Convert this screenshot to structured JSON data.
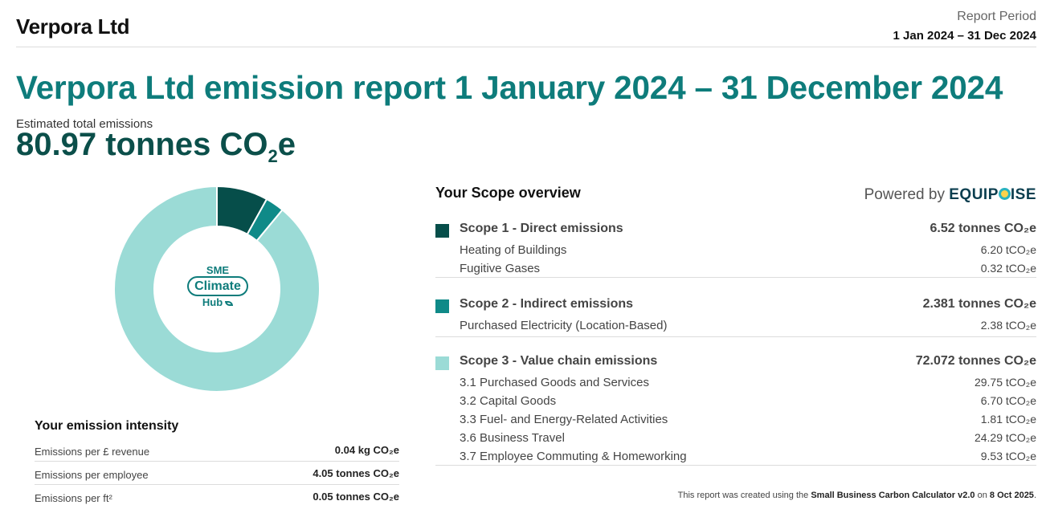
{
  "header": {
    "company": "Verpora Ltd",
    "period_label": "Report Period",
    "period_value": "1 Jan 2024 – 31 Dec 2024"
  },
  "title": "Verpora Ltd emission report 1 January 2024 – 31 December 2024",
  "total": {
    "label": "Estimated total emissions",
    "value": "80.97 tonnes CO",
    "sub": "2",
    "suffix": "e"
  },
  "logo": {
    "line1": "SME",
    "line2": "Climate",
    "line3": "Hub"
  },
  "colors": {
    "scope1": "#064e4a",
    "scope2": "#0f8a88",
    "scope3": "#9bdbd6",
    "accent": "#0e7c7b"
  },
  "chart_data": {
    "type": "pie",
    "donut": true,
    "slices": [
      {
        "name": "Scope 1 - Direct emissions",
        "value": 6.52
      },
      {
        "name": "Scope 2 - Indirect emissions",
        "value": 2.381
      },
      {
        "name": "Scope 3 - Value chain emissions",
        "value": 72.072
      }
    ]
  },
  "intensity": {
    "title": "Your emission intensity",
    "rows": [
      {
        "label": "Emissions per £ revenue",
        "value": "0.04 kg CO₂e"
      },
      {
        "label": "Emissions per employee",
        "value": "4.05 tonnes CO₂e"
      },
      {
        "label": "Emissions per ft²",
        "value": "0.05 tonnes CO₂e"
      }
    ]
  },
  "scope_overview": {
    "title": "Your Scope overview",
    "powered_prefix": "Powered by",
    "brand_a": "EQUIP",
    "brand_b": "ISE",
    "groups": [
      {
        "name": "Scope 1 - Direct emissions",
        "total": "6.52 tonnes CO₂e",
        "items": [
          {
            "label": "Heating of Buildings",
            "value": "6.20 tCO₂e"
          },
          {
            "label": "Fugitive Gases",
            "value": "0.32 tCO₂e"
          }
        ]
      },
      {
        "name": "Scope 2 - Indirect emissions",
        "total": "2.381 tonnes CO₂e",
        "items": [
          {
            "label": "Purchased Electricity (Location-Based)",
            "value": "2.38 tCO₂e"
          }
        ]
      },
      {
        "name": "Scope 3 - Value chain emissions",
        "total": "72.072 tonnes CO₂e",
        "items": [
          {
            "label": "3.1 Purchased Goods and Services",
            "value": "29.75 tCO₂e"
          },
          {
            "label": "3.2 Capital Goods",
            "value": "6.70 tCO₂e"
          },
          {
            "label": "3.3 Fuel- and Energy-Related Activities",
            "value": "1.81 tCO₂e"
          },
          {
            "label": "3.6 Business Travel",
            "value": "24.29 tCO₂e"
          },
          {
            "label": "3.7 Employee Commuting & Homeworking",
            "value": "9.53 tCO₂e"
          }
        ]
      }
    ]
  },
  "footer": {
    "prefix": "This report was created using the",
    "tool": "Small Business Carbon Calculator v2.0",
    "mid": "on",
    "date": "8 Oct 2025",
    "end": "."
  }
}
